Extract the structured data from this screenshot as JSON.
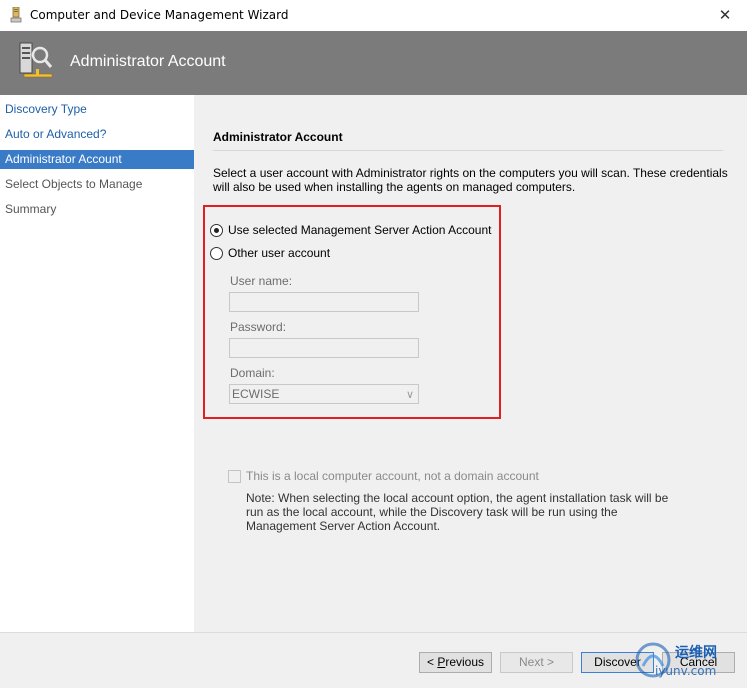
{
  "window": {
    "title": "Computer and Device Management Wizard",
    "close_glyph": "✕"
  },
  "banner": {
    "heading": "Administrator Account"
  },
  "nav": {
    "items": [
      {
        "label": "Discovery Type"
      },
      {
        "label": "Auto or Advanced?"
      },
      {
        "label": "Administrator Account"
      },
      {
        "label": "Select Objects to Manage"
      },
      {
        "label": "Summary"
      }
    ]
  },
  "content": {
    "section_title": "Administrator Account",
    "description": "Select a user account with Administrator rights on the computers you will scan. These credentials will also be used when installing the agents on managed computers.",
    "options": {
      "use_selected": "Use selected Management Server Action Account",
      "other_user": "Other user account",
      "selected": "use_selected"
    },
    "fields": {
      "username_label": "User name:",
      "username_value": "",
      "password_label": "Password:",
      "password_value": "",
      "domain_label": "Domain:",
      "domain_value": "ECWISE"
    },
    "local_account_checkbox": "This is a local computer account, not a domain account",
    "note": "Note:  When selecting the local account option, the agent installation task will be run as the local account, while the Discovery task will be run using the Management Server Action Account."
  },
  "footer": {
    "prev_label_prefix": "< ",
    "prev_underlined": "P",
    "prev_label_rest": "revious",
    "next_label": "Next >",
    "discover_label": "Discover",
    "cancel_label": "Cancel"
  },
  "watermark": {
    "line1": "运维网",
    "line2": "iyunv.com"
  },
  "colors": {
    "banner": "#7b7b7b",
    "nav_active": "#3a7bc8",
    "nav_link": "#1f5fa8",
    "highlight_border": "#e02020"
  }
}
